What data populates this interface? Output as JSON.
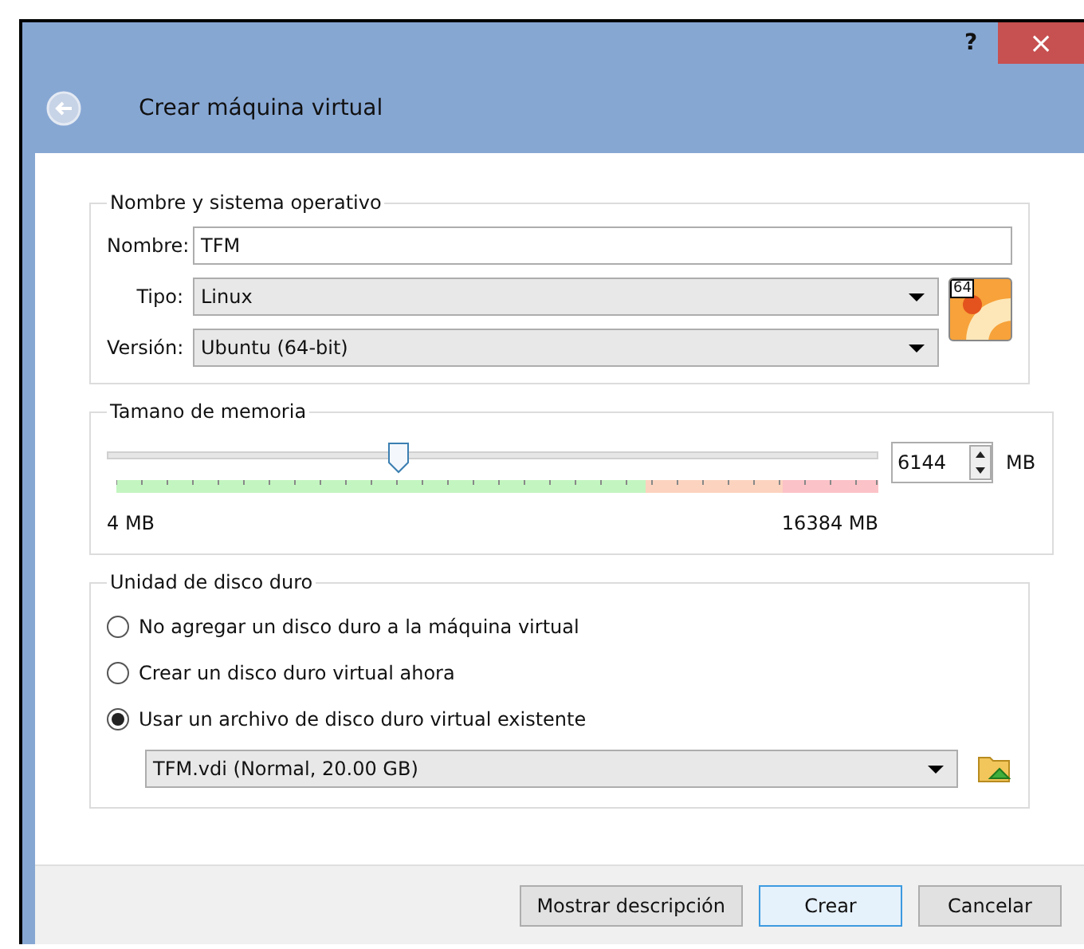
{
  "window": {
    "help": "?",
    "close": "×",
    "title": "Crear máquina virtual"
  },
  "name_os": {
    "legend": "Nombre y sistema operativo",
    "name_label": "Nombre:",
    "name_value": "TFM",
    "type_label": "Tipo:",
    "type_value": "Linux",
    "version_label": "Versión:",
    "version_value": "Ubuntu (64-bit)",
    "os_badge": "64"
  },
  "memory": {
    "legend": "Tamano de memoria",
    "level": 0.375,
    "value": "6144",
    "unit": "MB",
    "min_label": "4 MB",
    "max_label": "16384 MB"
  },
  "disk": {
    "legend": "Unidad de disco duro",
    "options": [
      {
        "label": "No agregar un disco duro a la máquina virtual",
        "selected": false
      },
      {
        "label": "Crear un disco duro virtual ahora",
        "selected": false
      },
      {
        "label": "Usar un archivo de disco duro virtual existente",
        "selected": true
      }
    ],
    "file": "TFM.vdi (Normal, 20.00 GB)"
  },
  "buttons": [
    {
      "label": "Mostrar descripción",
      "default": false
    },
    {
      "label": "Crear",
      "default": true
    },
    {
      "label": "Cancelar",
      "default": false
    }
  ]
}
